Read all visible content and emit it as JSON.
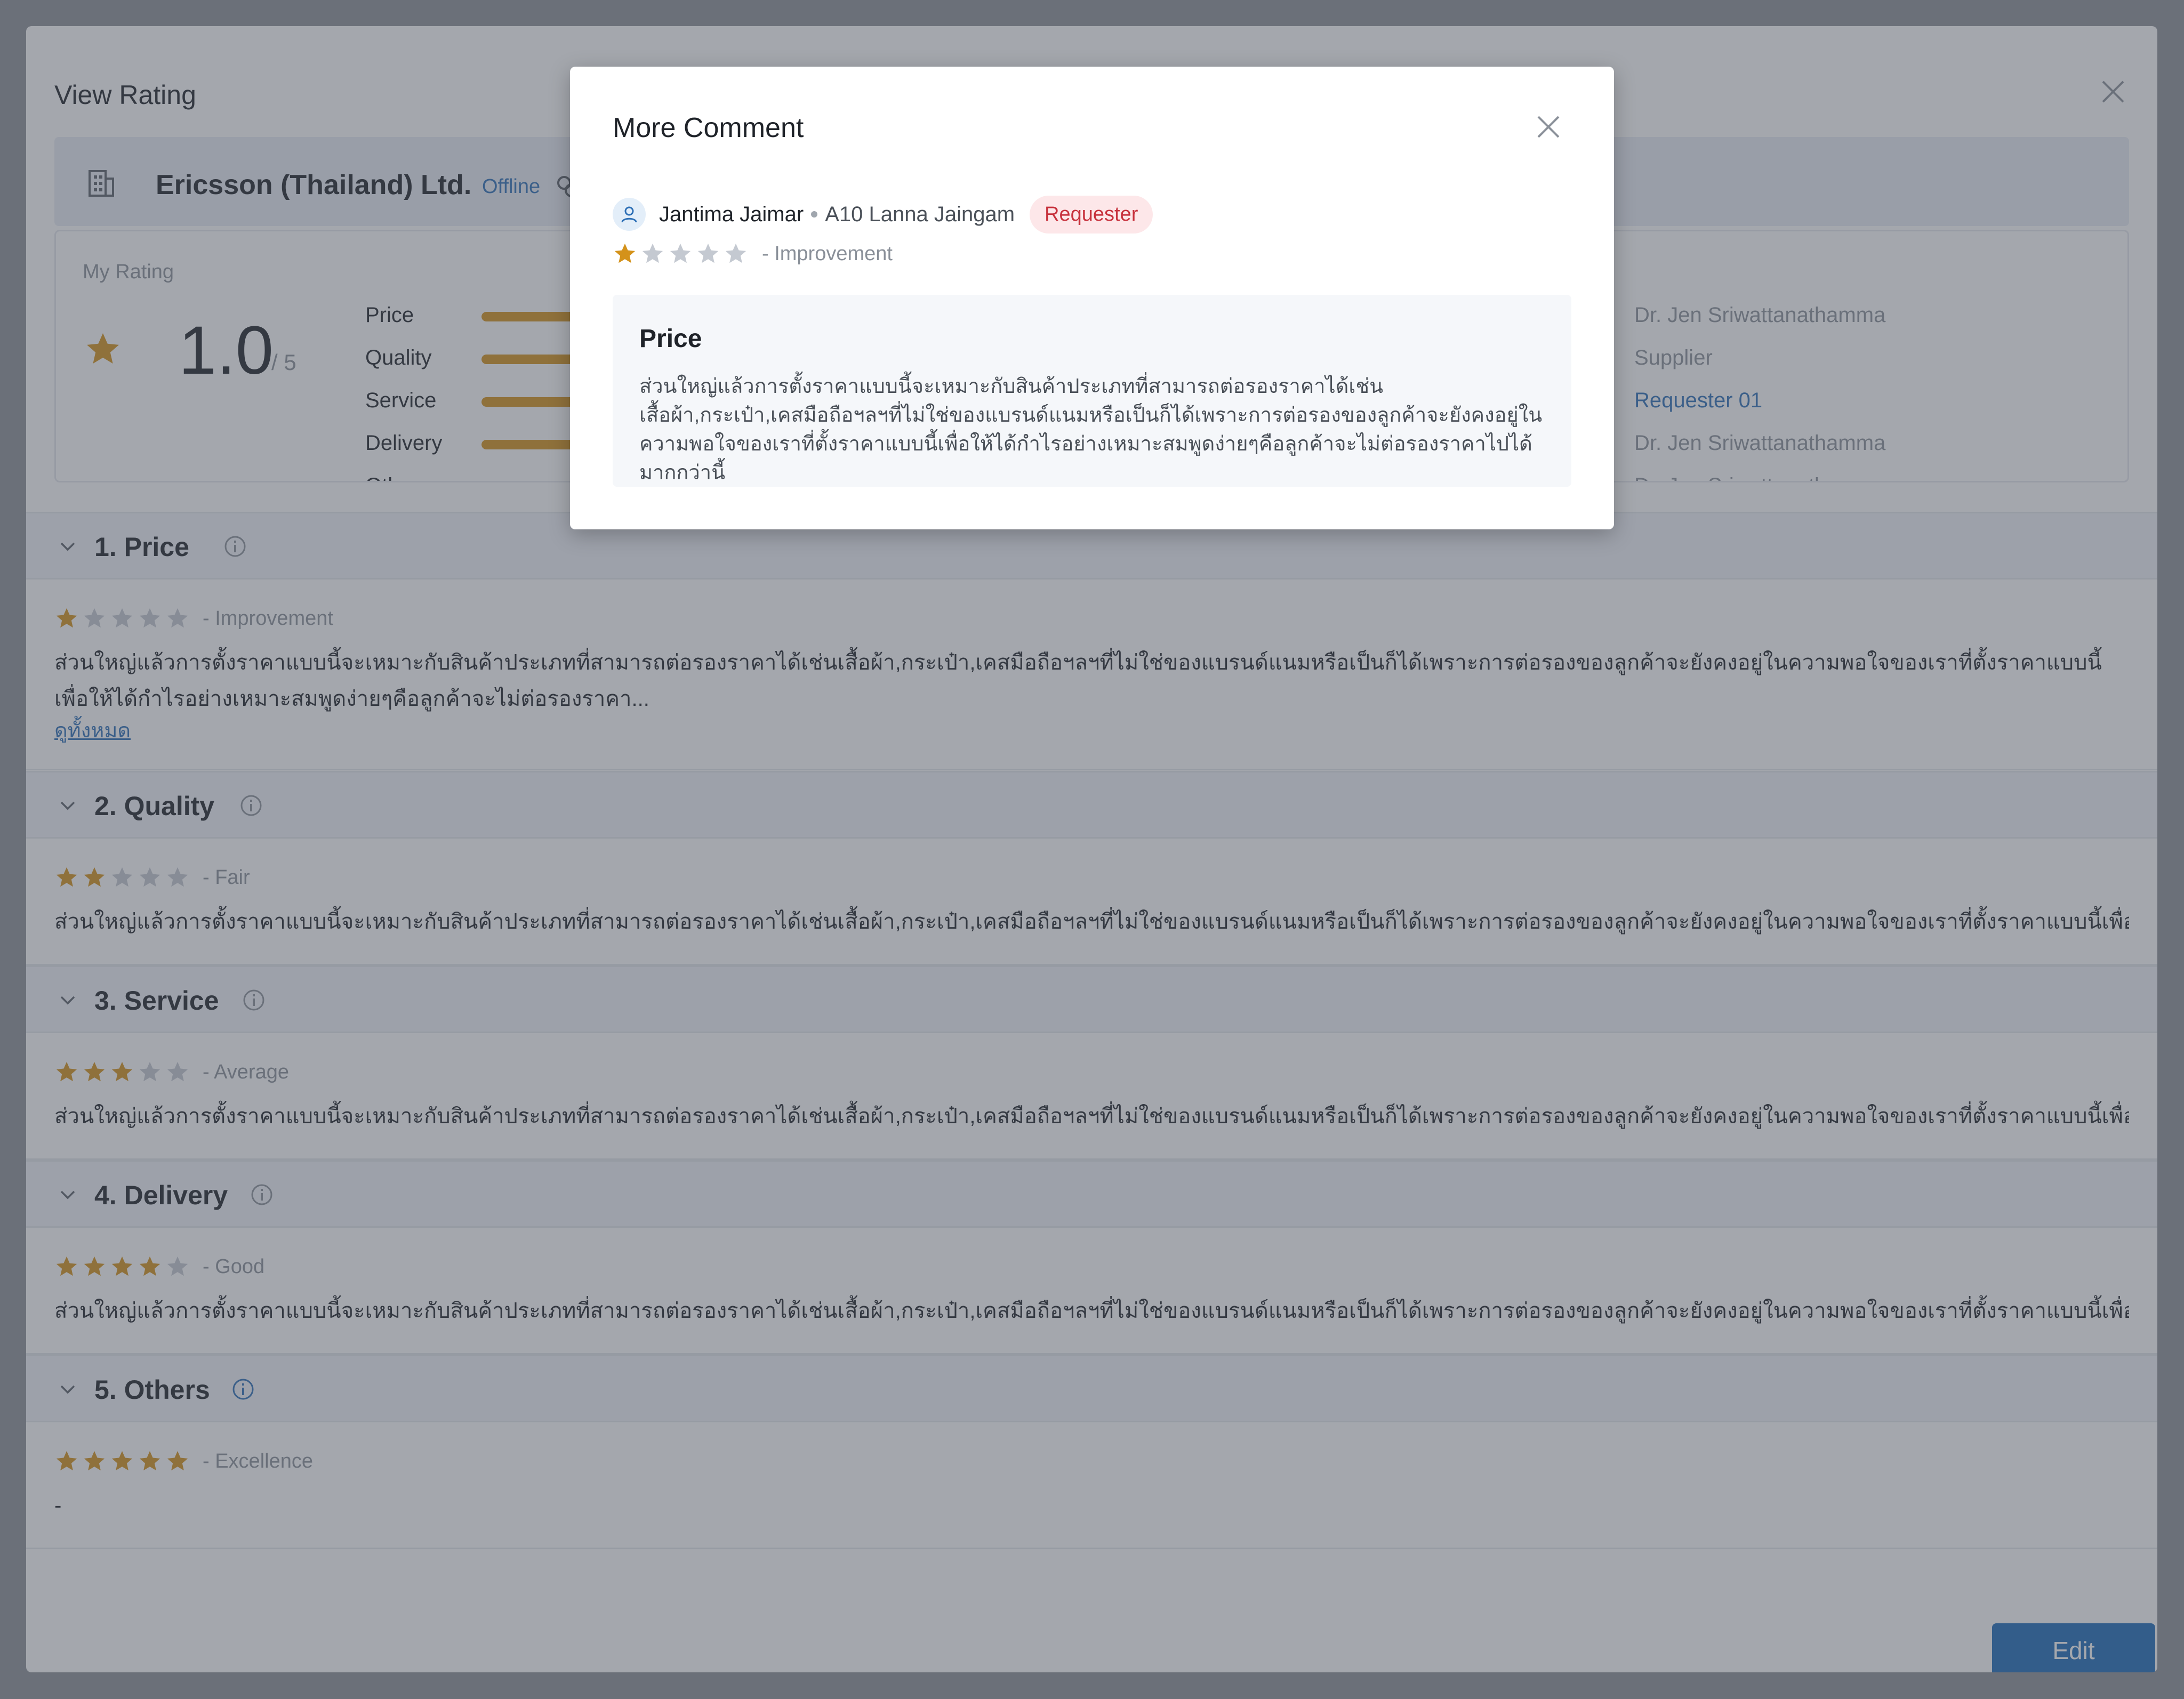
{
  "modal": {
    "title": "View Rating"
  },
  "supplier": {
    "name": "Ericsson (Thailand) Ltd.",
    "status": "Offline"
  },
  "my_rating": {
    "label": "My Rating",
    "score": "1.0",
    "out_of": "/ 5",
    "categories": [
      {
        "name": "Price",
        "fill": 0.5
      },
      {
        "name": "Quality",
        "fill": 0.5
      },
      {
        "name": "Service",
        "fill": 0.5
      },
      {
        "name": "Delivery",
        "fill": 0.5
      },
      {
        "name": "Others",
        "fill": 0.5
      }
    ],
    "raters": [
      "Dr. Jen Sriwattanathamma",
      "Supplier",
      "Requester 01",
      "Dr. Jen Sriwattanathamma",
      "Dr. Jen Sriwattanathamma"
    ]
  },
  "sections": [
    {
      "title": "1. Price",
      "stars": 1,
      "level": "- Improvement",
      "comment": "ส่วนใหญ่แล้วการตั้งราคาแบบนี้จะเหมาะกับสินค้าประเภทที่สามารถต่อรองราคาได้เช่นเสื้อผ้า,กระเป๋า,เคสมือถือฯลฯที่ไม่ใช่ของแบรนด์แนมหรือเป็นก็ได้เพราะการต่อรองของลูกค้าจะยังคงอยู่ในความพอใจของเราที่ตั้งราคาแบบนี้เพื่อให้ได้กำไรอย่างเหมาะสมพูดง่ายๆคือลูกค้าจะไม่ต่อรองราคา...",
      "see_all": "ดูทั้งหมด"
    },
    {
      "title": "2. Quality",
      "stars": 2,
      "level": "- Fair",
      "comment": "ส่วนใหญ่แล้วการตั้งราคาแบบนี้จะเหมาะกับสินค้าประเภทที่สามารถต่อรองราคาได้เช่นเสื้อผ้า,กระเป๋า,เคสมือถือฯลฯที่ไม่ใช่ของแบรนด์แนมหรือเป็นก็ได้เพราะการต่อรองของลูกค้าจะยังคงอยู่ในความพอใจของเราที่ตั้งราคาแบบนี้เพื่อให้ได้กำไรอย่างเหมาะสมพูดง่ายๆคื"
    },
    {
      "title": "3. Service",
      "stars": 3,
      "level": "- Average",
      "comment": "ส่วนใหญ่แล้วการตั้งราคาแบบนี้จะเหมาะกับสินค้าประเภทที่สามารถต่อรองราคาได้เช่นเสื้อผ้า,กระเป๋า,เคสมือถือฯลฯที่ไม่ใช่ของแบรนด์แนมหรือเป็นก็ได้เพราะการต่อรองของลูกค้าจะยังคงอยู่ในความพอใจของเราที่ตั้งราคาแบบนี้เพื่อให้ได้กำไรอย่างเหมาะสมพูดง่ายๆคื"
    },
    {
      "title": "4. Delivery",
      "stars": 4,
      "level": "- Good",
      "comment": "ส่วนใหญ่แล้วการตั้งราคาแบบนี้จะเหมาะกับสินค้าประเภทที่สามารถต่อรองราคาได้เช่นเสื้อผ้า,กระเป๋า,เคสมือถือฯลฯที่ไม่ใช่ของแบรนด์แนมหรือเป็นก็ได้เพราะการต่อรองของลูกค้าจะยังคงอยู่ในความพอใจของเราที่ตั้งราคาแบบนี้เพื่อให้ได้กำไรอย่างเหมาะสมพูดง่ายๆค"
    },
    {
      "title": "5. Others",
      "stars": 5,
      "level": "- Excellence",
      "comment": "-"
    }
  ],
  "edit_label": "Edit",
  "more_comment": {
    "title": "More Comment",
    "user_name": "Jantima Jaimar",
    "department": "A10 Lanna Jaingam",
    "role": "Requester",
    "stars": 1,
    "level": "- Improvement",
    "box_title": "Price",
    "box_text": "ส่วนใหญ่แล้วการตั้งราคาแบบนี้จะเหมาะกับสินค้าประเภทที่สามารถต่อรองราคาได้เช่นเสื้อผ้า,กระเป๋า,เคสมือถือฯลฯที่ไม่ใช่ของแบรนด์แนมหรือเป็นก็ได้เพราะการต่อรองของลูกค้าจะยังคงอยู่ในความพอใจของเราที่ตั้งราคาแบบนี้เพื่อให้ได้กำไรอย่างเหมาะสมพูดง่ายๆคือลูกค้าจะไม่ต่อรองราคาไปได้มากกว่านี้"
  },
  "colors": {
    "star_on": "#d4921a",
    "star_off": "#c4c9d1",
    "accent": "#1d6bb8",
    "badge_text": "#c7313c"
  }
}
